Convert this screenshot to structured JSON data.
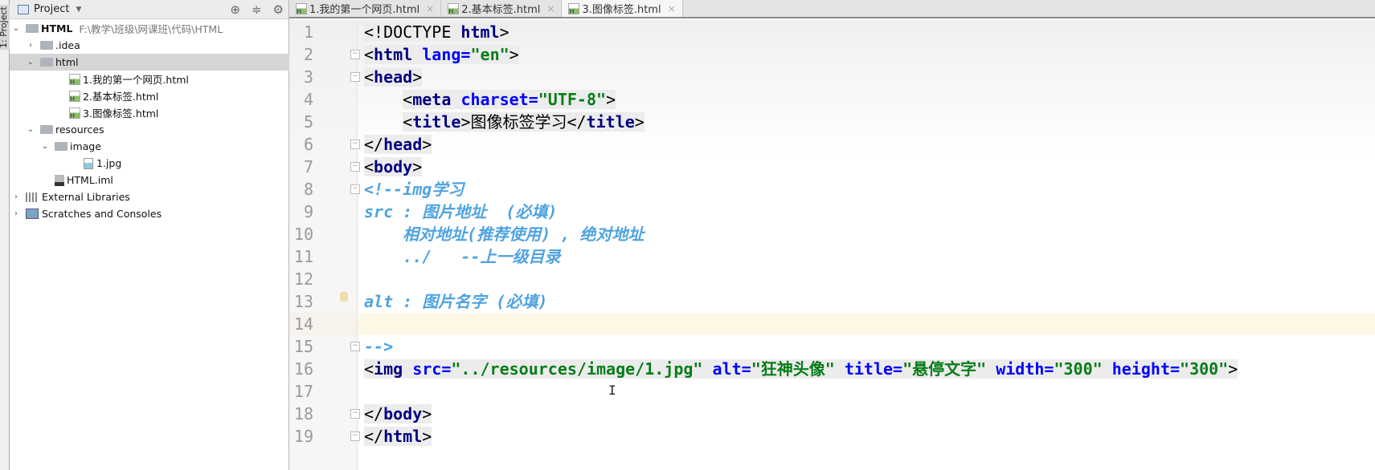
{
  "left_strip": {
    "label": "1: Project"
  },
  "sidebar": {
    "title": "Project",
    "tree": [
      {
        "label": "HTML",
        "path": "F:\\教学\\班级\\网课班\\代码\\HTML",
        "icon": "module-folder-icon",
        "expanded": true,
        "depth": 0
      },
      {
        "label": ".idea",
        "icon": "folder-icon",
        "expanded": false,
        "depth": 1
      },
      {
        "label": "html",
        "icon": "folder-icon",
        "expanded": true,
        "depth": 1,
        "selected": true
      },
      {
        "label": "1.我的第一个网页.html",
        "icon": "html-file-icon",
        "depth": 3
      },
      {
        "label": "2.基本标签.html",
        "icon": "html-file-icon",
        "depth": 3
      },
      {
        "label": "3.图像标签.html",
        "icon": "html-file-icon",
        "depth": 3
      },
      {
        "label": "resources",
        "icon": "folder-icon",
        "expanded": true,
        "depth": 1
      },
      {
        "label": "image",
        "icon": "folder-icon",
        "expanded": true,
        "depth": 2
      },
      {
        "label": "1.jpg",
        "icon": "image-file-icon",
        "depth": 4
      },
      {
        "label": "HTML.iml",
        "icon": "iml-file-icon",
        "depth": 2
      },
      {
        "label": "External Libraries",
        "icon": "library-icon",
        "expanded": false,
        "depth": 0
      },
      {
        "label": "Scratches and Consoles",
        "icon": "scratches-icon",
        "expanded": false,
        "depth": 0
      }
    ]
  },
  "tabs": [
    {
      "label": "1.我的第一个网页.html",
      "active": false
    },
    {
      "label": "2.基本标签.html",
      "active": false
    },
    {
      "label": "3.图像标签.html",
      "active": true
    }
  ],
  "editor": {
    "caret_line": 14,
    "lines": [
      {
        "n": "1",
        "tokens": [
          [
            "<!DOCTYPE ",
            "pn"
          ],
          [
            "html",
            "tg"
          ],
          [
            ">",
            "pn"
          ]
        ],
        "hl": true
      },
      {
        "n": "2",
        "tokens": [
          [
            "<",
            "pn"
          ],
          [
            "html",
            "tg"
          ],
          [
            " ",
            "pn"
          ],
          [
            "lang=",
            "at"
          ],
          [
            "\"en\"",
            "vl"
          ],
          [
            ">",
            "pn"
          ]
        ],
        "hl": true,
        "fold": true
      },
      {
        "n": "3",
        "tokens": [
          [
            "<",
            "pn"
          ],
          [
            "head",
            "tg"
          ],
          [
            ">",
            "pn"
          ]
        ],
        "hl": true,
        "fold": true
      },
      {
        "n": "4",
        "indent": "    ",
        "tokens": [
          [
            "<",
            "pn"
          ],
          [
            "meta",
            "tg"
          ],
          [
            " ",
            "pn"
          ],
          [
            "charset=",
            "at"
          ],
          [
            "\"UTF-8\"",
            "vl"
          ],
          [
            ">",
            "pn"
          ]
        ],
        "hl": true
      },
      {
        "n": "5",
        "indent": "    ",
        "tokens": [
          [
            "<",
            "pn"
          ],
          [
            "title",
            "tg"
          ],
          [
            ">",
            "pn"
          ],
          [
            "图像标签学习",
            "tx"
          ],
          [
            "</",
            "pn"
          ],
          [
            "title",
            "tg"
          ],
          [
            ">",
            "pn"
          ]
        ],
        "hl": true
      },
      {
        "n": "6",
        "tokens": [
          [
            "</",
            "pn"
          ],
          [
            "head",
            "tg"
          ],
          [
            ">",
            "pn"
          ]
        ],
        "hl": true,
        "fold": true
      },
      {
        "n": "7",
        "tokens": [
          [
            "<",
            "pn"
          ],
          [
            "body",
            "tg"
          ],
          [
            ">",
            "pn"
          ]
        ],
        "hl": true,
        "fold": true
      },
      {
        "n": "8",
        "tokens": [
          [
            "<!--img学习",
            "cm"
          ]
        ],
        "fold": true
      },
      {
        "n": "9",
        "tokens": [
          [
            "src : 图片地址  (必填)",
            "cm"
          ]
        ]
      },
      {
        "n": "10",
        "indent": "    ",
        "tokens": [
          [
            "相对地址(推荐使用) , 绝对地址",
            "cm"
          ]
        ]
      },
      {
        "n": "11",
        "indent": "    ",
        "tokens": [
          [
            "../   --上一级目录",
            "cm"
          ]
        ]
      },
      {
        "n": "12",
        "tokens": []
      },
      {
        "n": "13",
        "tokens": [
          [
            "alt : 图片名字 (必填)",
            "cm"
          ]
        ]
      },
      {
        "n": "14",
        "tokens": []
      },
      {
        "n": "15",
        "tokens": [
          [
            "-->",
            "cm"
          ]
        ],
        "fold": true
      },
      {
        "n": "16",
        "tokens": [
          [
            "<",
            "pn"
          ],
          [
            "img",
            "tg"
          ],
          [
            " ",
            "pn"
          ],
          [
            "src=",
            "at"
          ],
          [
            "\"../resources/image/1.jpg\"",
            "vl"
          ],
          [
            " ",
            "pn"
          ],
          [
            "alt=",
            "at"
          ],
          [
            "\"狂神头像\"",
            "vl"
          ],
          [
            " ",
            "pn"
          ],
          [
            "title=",
            "at"
          ],
          [
            "\"悬停文字\"",
            "vl"
          ],
          [
            " ",
            "pn"
          ],
          [
            "width=",
            "at"
          ],
          [
            "\"300\"",
            "vl"
          ],
          [
            " ",
            "pn"
          ],
          [
            "height=",
            "at"
          ],
          [
            "\"300\"",
            "vl"
          ],
          [
            ">",
            "pn"
          ]
        ],
        "hl": true
      },
      {
        "n": "17",
        "tokens": []
      },
      {
        "n": "18",
        "tokens": [
          [
            "</",
            "pn"
          ],
          [
            "body",
            "tg"
          ],
          [
            ">",
            "pn"
          ]
        ],
        "hl": true,
        "fold": true
      },
      {
        "n": "19",
        "tokens": [
          [
            "</",
            "pn"
          ],
          [
            "html",
            "tg"
          ],
          [
            ">",
            "pn"
          ]
        ],
        "hl": true,
        "fold": true
      }
    ]
  },
  "colors": {
    "tag": "#000080",
    "attr": "#0000ff",
    "value": "#067d17",
    "comment": "#4fa3e0",
    "caret_row": "#fdf8e6",
    "selected_row": "#d5d5d5"
  }
}
